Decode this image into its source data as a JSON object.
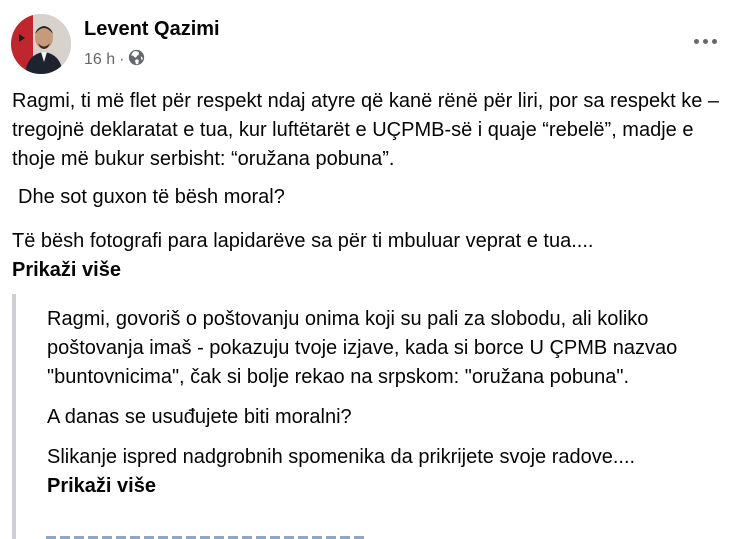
{
  "post": {
    "author": "Levent Qazimi",
    "time": "16 h",
    "separator": "·",
    "privacy_icon": "globe-icon",
    "paragraphs": [
      "Ragmi, ti më flet për respekt ndaj atyre që kanë rënë për liri, por sa respekt ke – tregojnë deklaratat e tua, kur luftëtarët e UÇPMB-së i quaje “rebelë”, madje e thoje më bukur serbisht: “oružana pobuna”.",
      "Dhe sot guxon të bësh moral?",
      "Të bësh fotografi para lapidarëve sa për ti mbuluar veprat e tua...."
    ],
    "see_more": "Prikaži više"
  },
  "translation": {
    "paragraphs": [
      "Ragmi, govoriš o poštovanju onima koji su pali za slobodu, ali koliko poštovanja imaš - pokazuju tvoje izjave, kada si borce U ÇPMB nazvao \"buntovnicima\", čak si bolje rekao na srpskom: \"oružana pobuna\".",
      "A danas se usuđujete biti moralni?",
      "Slikanje ispred nadgrobnih spomenika da prikrijete svoje radove...."
    ],
    "see_more": "Prikaži više"
  },
  "colors": {
    "text": "#050505",
    "secondary": "#65676b",
    "quote_border": "#ccd0d5"
  }
}
